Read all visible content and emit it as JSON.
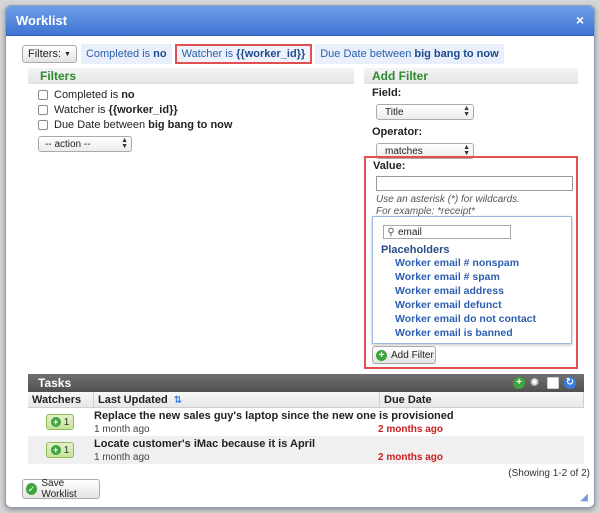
{
  "window": {
    "title": "Worklist",
    "close_glyph": "×"
  },
  "filterbar": {
    "button_label": "Filters:",
    "chips": [
      {
        "prefix": "Completed is",
        "value": "no"
      },
      {
        "prefix": "Watcher is",
        "value": "{{worker_id}}"
      },
      {
        "prefix": "Due Date between",
        "value": "big bang to now"
      }
    ]
  },
  "filters_panel": {
    "title": "Filters",
    "rows": [
      {
        "prefix": "Completed is",
        "value": "no"
      },
      {
        "prefix": "Watcher is",
        "value": "{{worker_id}}"
      },
      {
        "prefix": "Due Date between",
        "value": "big bang to now"
      }
    ],
    "action_select": "-- action --"
  },
  "add_filter_panel": {
    "title": "Add Filter",
    "field_label": "Field:",
    "field_value": "Title",
    "operator_label": "Operator:",
    "operator_value": "matches",
    "value_label": "Value:",
    "hint_line1": "Use an asterisk (*) for wildcards.",
    "hint_line2": "For example: *receipt*",
    "search_value": "email",
    "placeholders_title": "Placeholders",
    "placeholders": [
      "Worker email # nonspam",
      "Worker email # spam",
      "Worker email address",
      "Worker email defunct",
      "Worker email do not contact",
      "Worker email is banned"
    ],
    "add_button": "Add Filter"
  },
  "tasks": {
    "title": "Tasks",
    "columns": [
      "Watchers",
      "Last Updated",
      "Due Date"
    ],
    "rows": [
      {
        "watchers": "1",
        "title": "Replace the new sales guy's laptop since the new one is provisioned",
        "updated": "1 month ago",
        "due": "2 months ago"
      },
      {
        "watchers": "1",
        "title": "Locate customer's iMac because it is April",
        "updated": "1 month ago",
        "due": "2 months ago"
      }
    ],
    "showing": "(Showing 1-2 of 2)"
  },
  "save_button": "Save Worklist",
  "colors": {
    "accent": "#3f74d4",
    "highlight": "#e05050",
    "link": "#2c5fb0",
    "due_red": "#cc2020",
    "filters_green": "#2e8a2e"
  }
}
